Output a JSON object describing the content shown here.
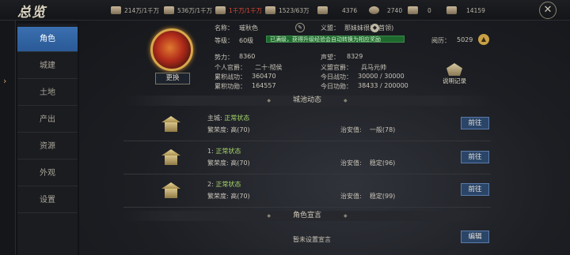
{
  "header": {
    "logo": "总览",
    "resources": [
      {
        "icon": "spear-icon",
        "value": "214万/1千万"
      },
      {
        "icon": "scroll-icon",
        "value": "536万/1千万"
      },
      {
        "icon": "ore-icon",
        "value": "1千万/1千万",
        "color": "#e04a3a"
      },
      {
        "icon": "lumber-icon",
        "value": "1523/63万"
      },
      {
        "icon": "sword-icon",
        "value": "4376"
      },
      {
        "icon": "jade-icon",
        "value": "2740"
      },
      {
        "icon": "silver-icon",
        "value": "0"
      },
      {
        "icon": "ingot-icon",
        "value": "14159"
      }
    ],
    "close_icon": "close-icon"
  },
  "sidebar": {
    "items": [
      {
        "label": "角色",
        "active": true
      },
      {
        "label": "城建"
      },
      {
        "label": "土地"
      },
      {
        "label": "产出"
      },
      {
        "label": "资源"
      },
      {
        "label": "外观"
      },
      {
        "label": "设置"
      }
    ]
  },
  "profile": {
    "change_label": "更换",
    "name_label": "名称：",
    "name": "璀秋色",
    "level_label": "等级：",
    "level": "60级",
    "exp_text": "已满级，获得升级经验会自动转换为相应奖励",
    "alliance_label": "义盟：",
    "alliance": "那妹妹很棒(首领)",
    "experience_label": "阅历：",
    "experience": "5029",
    "power_label": "势力：",
    "power": "8360",
    "fame_label": "声望：",
    "fame": "8329",
    "rank_label": "个人官爵：",
    "rank": "二十·彻侯",
    "alliance_rank_label": "义盟官爵：",
    "alliance_rank": "兵马元帅",
    "total_battle_label": "累积战功：",
    "total_battle": "360470",
    "today_battle_label": "今日战功：",
    "today_battle": "30000 / 30000",
    "total_merit_label": "累积功勋：",
    "total_merit": "164557",
    "today_merit_label": "今日功勋：",
    "today_merit": "38433 / 200000",
    "records_label": "说明记录"
  },
  "city_section": {
    "title": "城池动态",
    "cities": [
      {
        "name": "主城:",
        "status": "正常状态",
        "prosperity_label": "繁荣度:",
        "prosperity": "高(70)",
        "order_label": "治安值:",
        "order": "一般(78)",
        "button": "前往"
      },
      {
        "name": "1:",
        "status": "正常状态",
        "prosperity_label": "繁荣度:",
        "prosperity": "高(70)",
        "order_label": "治安值:",
        "order": "稳定(96)",
        "button": "前往"
      },
      {
        "name": "2:",
        "status": "正常状态",
        "prosperity_label": "繁荣度:",
        "prosperity": "高(70)",
        "order_label": "治安值:",
        "order": "稳定(99)",
        "button": "前往"
      }
    ]
  },
  "declaration_section": {
    "title": "角色宣言",
    "text": "暂未设置宣言",
    "edit_button": "编辑"
  },
  "colors": {
    "accent": "#2a5a96",
    "status_green": "#a8d86a",
    "gold": "#d8a84c"
  }
}
